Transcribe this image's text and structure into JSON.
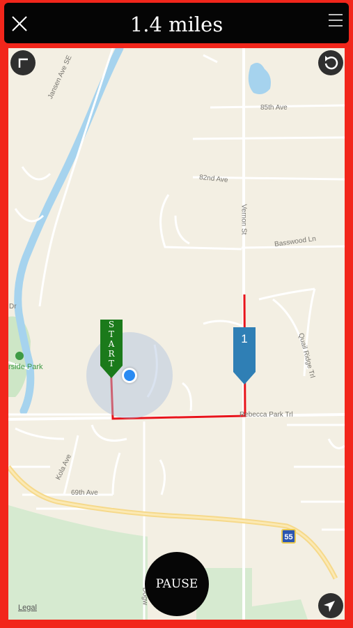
{
  "header": {
    "distance": "1.4 miles",
    "close_icon": "close-icon",
    "menu_icon": "hamburger-menu-icon"
  },
  "map": {
    "streets": {
      "jansen": "Jansen Ave SE",
      "ave85": "85th Ave",
      "ave82": "82nd Ave",
      "vernon": "Vernon St",
      "basswood": "Basswood Ln",
      "quail": "Quail Ridge Trl",
      "rebecca": "Rebecca Park Trl",
      "kola": "Kola Ave",
      "ave69": "69th Ave",
      "dogw": "Dogw",
      "dr": "Dr",
      "park": "rside Park"
    },
    "highway_shield": "55",
    "start_marker": [
      "S",
      "T",
      "A",
      "R",
      "T"
    ],
    "waypoint_marker": "1",
    "legal": "Legal",
    "pause_label": "PAUSE",
    "colors": {
      "frame": "#f2261b",
      "route": "#e8141b",
      "start_marker": "#1b7a1b",
      "waypoint_marker": "#2f7fb5",
      "user_location": "#2a8bf2"
    },
    "icons": {
      "corner": "corner-bracket-icon",
      "undo": "undo-arrow-icon",
      "locate": "location-arrow-icon"
    }
  }
}
